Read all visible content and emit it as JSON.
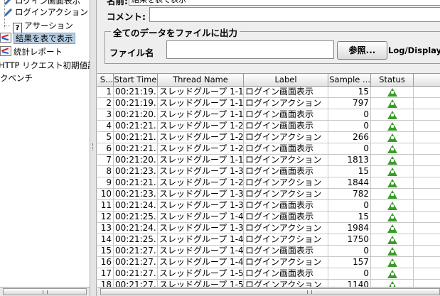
{
  "tree": {
    "items": [
      {
        "label": "ログイン画面表示",
        "icon": "pen-icon"
      },
      {
        "label": "ログインアクション",
        "icon": "pen-icon"
      },
      {
        "label": "アサーション",
        "icon": "assertion-icon"
      },
      {
        "label": "結果を表で表示",
        "icon": "chart-icon",
        "selected": true
      },
      {
        "label": "統計レポート",
        "icon": "chart-icon"
      },
      {
        "label": "HTTP リクエスト初期値設",
        "icon": ""
      },
      {
        "label": "クベンチ",
        "icon": ""
      }
    ]
  },
  "form": {
    "name_label": "名前:",
    "name_value": "結果を表で表示",
    "comment_label": "コメント:",
    "file_group_title": "全てのデータをファイルに出力",
    "file_label": "ファイル名",
    "browse_button": "参照...",
    "log_display": "Log/Display O"
  },
  "table": {
    "columns": [
      "S...",
      "Start Time",
      "Thread Name",
      "Label",
      "Sample ...",
      "Status",
      ""
    ],
    "rows": [
      {
        "n": "1",
        "time": "00:21:19...",
        "thread": "スレッドグループ 1-1",
        "label": "ログイン画面表示",
        "sample": "15"
      },
      {
        "n": "2",
        "time": "00:21:19...",
        "thread": "スレッドグループ 1-1",
        "label": "ログインアクション",
        "sample": "797"
      },
      {
        "n": "3",
        "time": "00:21:20...",
        "thread": "スレッドグループ 1-1",
        "label": "ログイン画面表示",
        "sample": "0"
      },
      {
        "n": "4",
        "time": "00:21:21...",
        "thread": "スレッドグループ 1-2",
        "label": "ログイン画面表示",
        "sample": "0"
      },
      {
        "n": "5",
        "time": "00:21:21...",
        "thread": "スレッドグループ 1-2",
        "label": "ログインアクション",
        "sample": "266"
      },
      {
        "n": "6",
        "time": "00:21:21...",
        "thread": "スレッドグループ 1-2",
        "label": "ログイン画面表示",
        "sample": "0"
      },
      {
        "n": "7",
        "time": "00:21:20...",
        "thread": "スレッドグループ 1-1",
        "label": "ログインアクション",
        "sample": "1813"
      },
      {
        "n": "8",
        "time": "00:21:23...",
        "thread": "スレッドグループ 1-3",
        "label": "ログイン画面表示",
        "sample": "15"
      },
      {
        "n": "9",
        "time": "00:21:21...",
        "thread": "スレッドグループ 1-2",
        "label": "ログインアクション",
        "sample": "1844"
      },
      {
        "n": "10",
        "time": "00:21:23...",
        "thread": "スレッドグループ 1-3",
        "label": "ログインアクション",
        "sample": "782"
      },
      {
        "n": "11",
        "time": "00:21:24...",
        "thread": "スレッドグループ 1-3",
        "label": "ログイン画面表示",
        "sample": "0"
      },
      {
        "n": "12",
        "time": "00:21:25...",
        "thread": "スレッドグループ 1-4",
        "label": "ログイン画面表示",
        "sample": "15"
      },
      {
        "n": "13",
        "time": "00:21:24...",
        "thread": "スレッドグループ 1-3",
        "label": "ログインアクション",
        "sample": "1984"
      },
      {
        "n": "14",
        "time": "00:21:25...",
        "thread": "スレッドグループ 1-4",
        "label": "ログインアクション",
        "sample": "1750"
      },
      {
        "n": "15",
        "time": "00:21:27...",
        "thread": "スレッドグループ 1-4",
        "label": "ログイン画面表示",
        "sample": "0"
      },
      {
        "n": "16",
        "time": "00:21:27...",
        "thread": "スレッドグループ 1-4",
        "label": "ログインアクション",
        "sample": "157"
      },
      {
        "n": "17",
        "time": "00:21:27...",
        "thread": "スレッドグループ 1-5",
        "label": "ログイン画面表示",
        "sample": "0"
      },
      {
        "n": "18",
        "time": "00:21:27...",
        "thread": "スレッドグループ 1-5",
        "label": "ログインアクション",
        "sample": "1140"
      }
    ],
    "status_icon": "success-triangle-icon",
    "status_color": "#3b9a2c"
  }
}
